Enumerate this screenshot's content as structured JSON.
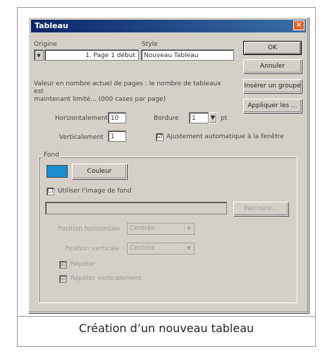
{
  "dialog": {
    "title": "Tableau",
    "close_glyph": "×"
  },
  "labels": {
    "origin": "Origine",
    "style": "Style",
    "note": "Valeur en nombre actuel de pages : le nombre de tableaux est\nmaintenant limité... (000 cases par page)",
    "horizontal": "Horizontalement",
    "vertical": "Verticalement",
    "border": "Bordure",
    "auto_fit": "Ajustement automatique à la fenêtre",
    "background": "Fond",
    "use_image": "Utiliser l'image de fond",
    "horizontal_position": "Position horizontale",
    "vertical_position": "Position verticale",
    "repeat_x": "Répéter",
    "repeat_y": "Répéter verticalement"
  },
  "fields": {
    "origin_value": "1. Page 1 début",
    "origin_select": "▼",
    "style_value": "Nouveau Tableau",
    "horizontal_value": "10",
    "vertical_value": "1",
    "border_value": "1",
    "border_unit": "pt",
    "image_path": "",
    "h_position_value": "Centrée",
    "v_position_value": "Centrée"
  },
  "checks": {
    "auto_fit": "☑",
    "use_image": "☐",
    "repeat_x": "☑",
    "repeat_y": "☑"
  },
  "buttons": {
    "ok": "OK",
    "cancel": "Annuler",
    "insert": "Insérer un groupe",
    "apply": "Appliquer les ...",
    "color": "Couleur",
    "browse": "Parcourir..."
  },
  "colors": {
    "swatch": "#1a8fd0"
  },
  "caption": "Création d’un nouveau tableau"
}
